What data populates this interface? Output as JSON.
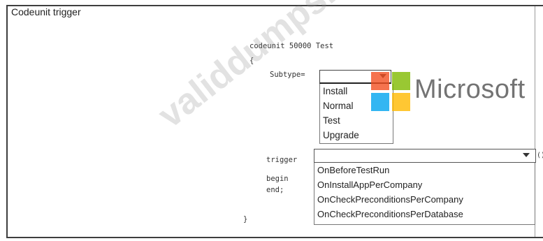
{
  "panel": {
    "title": "Codeunit trigger"
  },
  "code": {
    "line1": "codeunit 50000 Test",
    "open_brace": "{",
    "subtype_label": "Subtype=",
    "trigger_kw": "trigger",
    "begin_kw": "begin",
    "end_kw": "end;",
    "close_brace": "}",
    "paren": "()"
  },
  "subtype_dropdown": {
    "selected": "",
    "options": [
      "Install",
      "Normal",
      "Test",
      "Upgrade"
    ]
  },
  "trigger_dropdown": {
    "selected": "",
    "options": [
      "OnBeforeTestRun",
      "OnInstallAppPerCompany",
      "OnCheckPreconditionsPerCompany",
      "OnCheckPreconditionsPerDatabase"
    ]
  },
  "logo": {
    "text": "Microsoft",
    "colors": [
      "#f25022",
      "#7fba00",
      "#00a4ef",
      "#ffb900"
    ]
  },
  "watermark": {
    "text": "validdumps.top"
  },
  "icons": {
    "dropdown_arrow": "chevron-down-icon"
  }
}
